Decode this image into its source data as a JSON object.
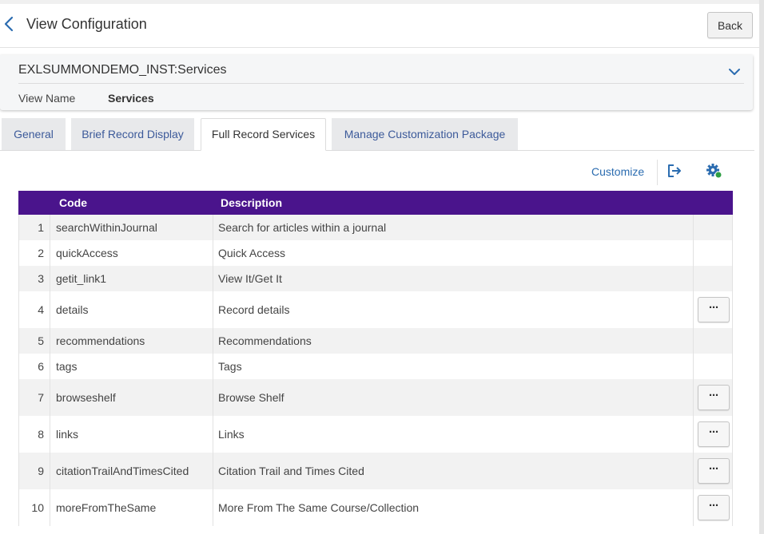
{
  "header": {
    "title": "View Configuration",
    "back_label": "Back"
  },
  "config": {
    "title": "EXLSUMMONDEMO_INST:Services",
    "view_name_label": "View Name",
    "view_name_value": "Services"
  },
  "tabs": [
    {
      "label": "General",
      "active": false
    },
    {
      "label": "Brief Record Display",
      "active": false
    },
    {
      "label": "Full Record Services",
      "active": true
    },
    {
      "label": "Manage Customization Package",
      "active": false
    }
  ],
  "toolbar": {
    "customize_label": "Customize",
    "export_icon": "export-icon",
    "settings_icon": "gear-status-icon"
  },
  "table": {
    "columns": [
      "",
      "Code",
      "Description",
      ""
    ],
    "action_label": "⋯",
    "rows": [
      {
        "num": "1",
        "code": "searchWithinJournal",
        "description": "Search for articles within a journal",
        "has_actions": false
      },
      {
        "num": "2",
        "code": "quickAccess",
        "description": "Quick Access",
        "has_actions": false
      },
      {
        "num": "3",
        "code": "getit_link1",
        "description": "View It/Get It",
        "has_actions": false
      },
      {
        "num": "4",
        "code": "details",
        "description": "Record details",
        "has_actions": true
      },
      {
        "num": "5",
        "code": "recommendations",
        "description": "Recommendations",
        "has_actions": false
      },
      {
        "num": "6",
        "code": "tags",
        "description": "Tags",
        "has_actions": false
      },
      {
        "num": "7",
        "code": "browseshelf",
        "description": "Browse Shelf",
        "has_actions": true
      },
      {
        "num": "8",
        "code": "links",
        "description": "Links",
        "has_actions": true
      },
      {
        "num": "9",
        "code": "citationTrailAndTimesCited",
        "description": "Citation Trail and Times Cited",
        "has_actions": true
      },
      {
        "num": "10",
        "code": "moreFromTheSame",
        "description": "More From The Same Course/Collection",
        "has_actions": true
      }
    ]
  },
  "colors": {
    "accent": "#4a148c",
    "link": "#2b6cb0",
    "status_green": "#2e9e44"
  }
}
